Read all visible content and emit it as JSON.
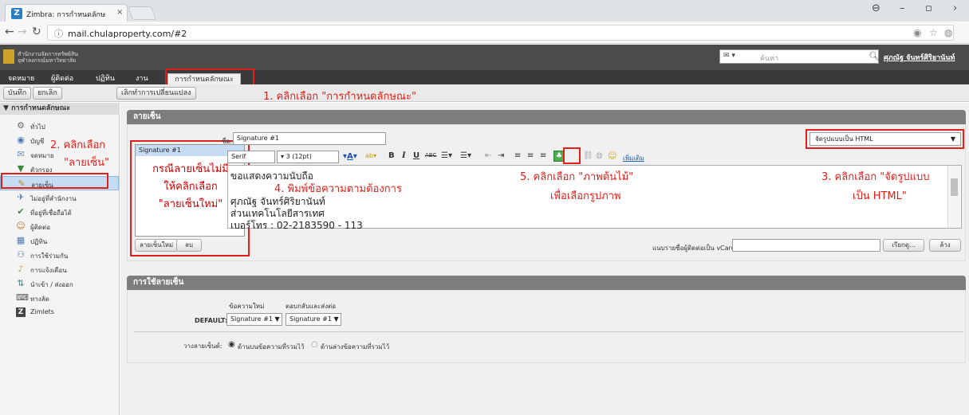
{
  "browser": {
    "tab_title": "Zimbra: การกำหนดลักษณะ",
    "tab_close": "×",
    "url": "mail.chulaproperty.com/#2",
    "url_info_icon": "ⓘ"
  },
  "header": {
    "logo_line1": "สำนักงานจัดการทรัพย์สิน",
    "logo_line2": "จุฬาลงกรณ์มหาวิทยาลัย",
    "search_placeholder": "ค้นหา",
    "user": "ศุภณัฐ จันทร์ศิริยานันท์"
  },
  "apps": [
    "จดหมาย",
    "ผู้ติดต่อ",
    "ปฏิทิน",
    "งาน"
  ],
  "active_tab": "การกำหนดลักษณะ",
  "toolbar": {
    "save": "บันทึก",
    "cancel": "ยกเลิก",
    "undo": "เลิกทำการเปลี่ยนแปลง"
  },
  "sidebar": {
    "header": "การกำหนดลักษณะ",
    "items": [
      {
        "label": "ทั่วไป",
        "icon": "⚙"
      },
      {
        "label": "บัญชี",
        "icon": "◉"
      },
      {
        "label": "จดหมาย",
        "icon": "✉"
      },
      {
        "label": "ตัวกรอง",
        "icon": "▼"
      },
      {
        "label": "ลายเซ็น",
        "icon": "✎"
      },
      {
        "label": "ไม่อยู่ที่สำนักงาน",
        "icon": "✈"
      },
      {
        "label": "ที่อยู่ที่เชื่อถือได้",
        "icon": "✔"
      },
      {
        "label": "ผู้ติดต่อ",
        "icon": "☺"
      },
      {
        "label": "ปฏิทิน",
        "icon": "▦"
      },
      {
        "label": "การใช้ร่วมกัน",
        "icon": "⚇"
      },
      {
        "label": "การแจ้งเตือน",
        "icon": "♪"
      },
      {
        "label": "นำเข้า / ส่งออก",
        "icon": "⇅"
      },
      {
        "label": "ทางลัด",
        "icon": "⌨"
      },
      {
        "label": "Zimlets",
        "icon": "Z"
      }
    ]
  },
  "signature": {
    "section_title": "ลายเซ็น",
    "list": [
      "Signature #1"
    ],
    "name_label": "ชื่อ:",
    "name_value": "Signature #1",
    "format_value": "จัดรูปแบบเป็น HTML",
    "font_family": "Serif",
    "font_size": "3 (12pt)",
    "more_link": "เพิ่มเติม",
    "body_lines": [
      "ขอแสดงความนับถือ",
      "",
      "ศุภณัฐ จันทร์ศิริยานันท์",
      "ส่วนเทคโนโลยีสารเทศ",
      "เบอร์โทร : 02-2183590 - 113"
    ],
    "new_button": "ลายเซ็นใหม่",
    "delete_button": "ลบ",
    "vcard_label": "แนบรายชื่อผู้ติดต่อเป็น vCard:",
    "browse_button": "เรียกดู...",
    "clear_button": "ล้าง"
  },
  "usage": {
    "section_title": "การใช้ลายเซ็น",
    "col_new": "ข้อความใหม่",
    "col_reply": "ตอบกลับและส่งต่อ",
    "default_label": "DEFAULT:",
    "default_new": "Signature #1",
    "default_reply": "Signature #1",
    "place_label": "วางลายเซ็นต์:",
    "place_opt1": "ด้านบนข้อความที่รวมไว้",
    "place_opt2": "ด้านล่างข้อความที่รวมไว้"
  },
  "annotations": {
    "a1": "1. คลิกเลือก \"การกำหนดลักษณะ\"",
    "a2_line1": "2. คลิกเลือก",
    "a2_line2": "\"ลายเซ็น\"",
    "a3_line1": "3. คลิกเลือก \"จัดรูปแบบ",
    "a3_line2": "เป็น HTML\"",
    "a4": "4. พิมพ์ข้อความตามต้องการ",
    "a5_line1": "5. คลิกเลือก \"ภาพต้นไม้\"",
    "a5_line2": "เพื่อเลือกรูปภาพ",
    "hint_line1": "กรณีลายเซ็นไม่มี",
    "hint_line2": "ให้คลิกเลือก",
    "hint_line3": "\"ลายเซ็นใหม่\""
  },
  "colors": {
    "annotation": "#e0201a",
    "header_bg": "#4b4b4b",
    "selected": "#c6dcf3"
  }
}
